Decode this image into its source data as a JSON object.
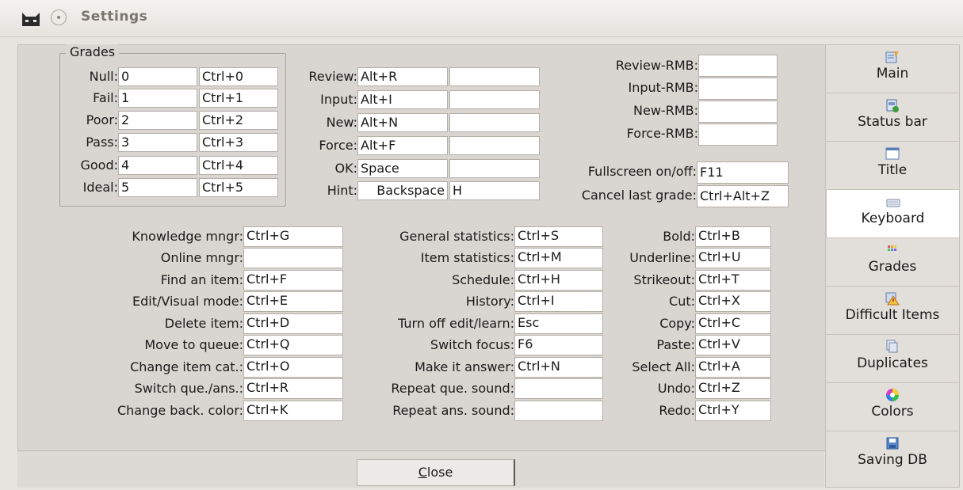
{
  "window": {
    "title": "Settings"
  },
  "grades": {
    "title": "Grades",
    "rows": [
      {
        "label": "Null:",
        "key": "0",
        "shortcut": "Ctrl+0"
      },
      {
        "label": "Fail:",
        "key": "1",
        "shortcut": "Ctrl+1"
      },
      {
        "label": "Poor:",
        "key": "2",
        "shortcut": "Ctrl+2"
      },
      {
        "label": "Pass:",
        "key": "3",
        "shortcut": "Ctrl+3"
      },
      {
        "label": "Good:",
        "key": "4",
        "shortcut": "Ctrl+4"
      },
      {
        "label": "Ideal:",
        "key": "5",
        "shortcut": "Ctrl+5"
      }
    ]
  },
  "actions": [
    {
      "label": "Review:",
      "key": "Alt+R",
      "alt": ""
    },
    {
      "label": "Input:",
      "key": "Alt+I",
      "alt": ""
    },
    {
      "label": "New:",
      "key": "Alt+N",
      "alt": ""
    },
    {
      "label": "Force:",
      "key": "Alt+F",
      "alt": ""
    },
    {
      "label": "OK:",
      "key": "Space",
      "alt": ""
    },
    {
      "label": "Hint:",
      "key": "Backspace",
      "alt": "H"
    }
  ],
  "rmb": [
    {
      "label": "Review-RMB:",
      "value": ""
    },
    {
      "label": "Input-RMB:",
      "value": ""
    },
    {
      "label": "New-RMB:",
      "value": ""
    },
    {
      "label": "Force-RMB:",
      "value": ""
    }
  ],
  "misc": [
    {
      "label": "Fullscreen on/off:",
      "value": "F11"
    },
    {
      "label": "Cancel last grade:",
      "value": "Ctrl+Alt+Z"
    }
  ],
  "col1": [
    {
      "label": "Knowledge mngr:",
      "value": "Ctrl+G"
    },
    {
      "label": "Online mngr:",
      "value": ""
    },
    {
      "label": "Find an item:",
      "value": "Ctrl+F"
    },
    {
      "label": "Edit/Visual mode:",
      "value": "Ctrl+E"
    },
    {
      "label": "Delete item:",
      "value": "Ctrl+D"
    },
    {
      "label": "Move to queue:",
      "value": "Ctrl+Q"
    },
    {
      "label": "Change item cat.:",
      "value": "Ctrl+O"
    },
    {
      "label": "Switch que./ans.:",
      "value": "Ctrl+R"
    },
    {
      "label": "Change back. color:",
      "value": "Ctrl+K"
    }
  ],
  "col2": [
    {
      "label": "General statistics:",
      "value": "Ctrl+S"
    },
    {
      "label": "Item statistics:",
      "value": "Ctrl+M"
    },
    {
      "label": "Schedule:",
      "value": "Ctrl+H"
    },
    {
      "label": "History:",
      "value": "Ctrl+I"
    },
    {
      "label": "Turn off edit/learn:",
      "value": "Esc"
    },
    {
      "label": "Switch focus:",
      "value": "F6"
    },
    {
      "label": "Make it answer:",
      "value": "Ctrl+N"
    },
    {
      "label": "Repeat que. sound:",
      "value": ""
    },
    {
      "label": "Repeat ans. sound:",
      "value": ""
    }
  ],
  "col3": [
    {
      "label": "Bold:",
      "value": "Ctrl+B"
    },
    {
      "label": "Underline:",
      "value": "Ctrl+U"
    },
    {
      "label": "Strikeout:",
      "value": "Ctrl+T"
    },
    {
      "label": "Cut:",
      "value": "Ctrl+X"
    },
    {
      "label": "Copy:",
      "value": "Ctrl+C"
    },
    {
      "label": "Paste:",
      "value": "Ctrl+V"
    },
    {
      "label": "Select All:",
      "value": "Ctrl+A"
    },
    {
      "label": "Undo:",
      "value": "Ctrl+Z"
    },
    {
      "label": "Redo:",
      "value": "Ctrl+Y"
    }
  ],
  "footer": {
    "close_label": "lose",
    "close_mnemonic": "C"
  },
  "sidebar": {
    "items": [
      {
        "label": "Main",
        "icon": "main-icon"
      },
      {
        "label": "Status bar",
        "icon": "status-bar-icon"
      },
      {
        "label": "Title",
        "icon": "title-icon"
      },
      {
        "label": "Keyboard",
        "icon": "keyboard-icon",
        "active": true
      },
      {
        "label": "Grades",
        "icon": "grades-icon"
      },
      {
        "label": "Difficult Items",
        "icon": "difficult-items-icon"
      },
      {
        "label": "Duplicates",
        "icon": "duplicates-icon"
      },
      {
        "label": "Colors",
        "icon": "colors-icon"
      },
      {
        "label": "Saving DB",
        "icon": "save-icon"
      }
    ]
  }
}
